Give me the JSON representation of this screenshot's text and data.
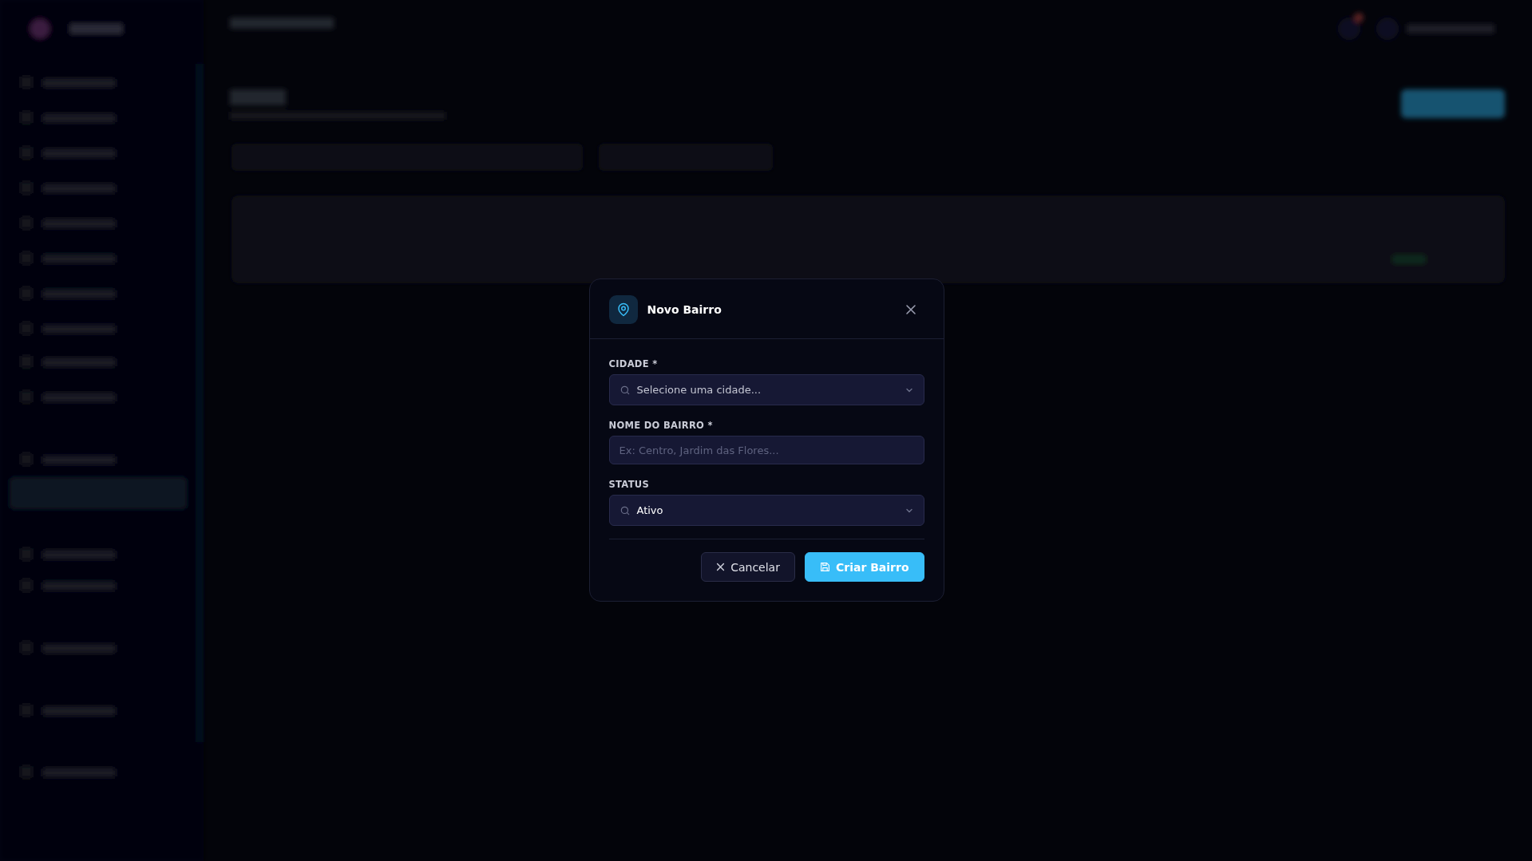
{
  "dialog": {
    "title": "Novo Bairro",
    "fields": [
      {
        "kind": "select",
        "label": "CIDADE *",
        "placeholder": "Selecione uma cidade..."
      },
      {
        "kind": "text",
        "label": "NOME DO BAIRRO *",
        "placeholder": "Ex: Centro, Jardim das Flores..."
      },
      {
        "kind": "select",
        "label": "STATUS",
        "value": "Ativo"
      }
    ],
    "buttons": [
      {
        "kind": "secondary",
        "label": "Cancelar"
      },
      {
        "kind": "primary",
        "label": "Criar Bairro"
      }
    ]
  }
}
